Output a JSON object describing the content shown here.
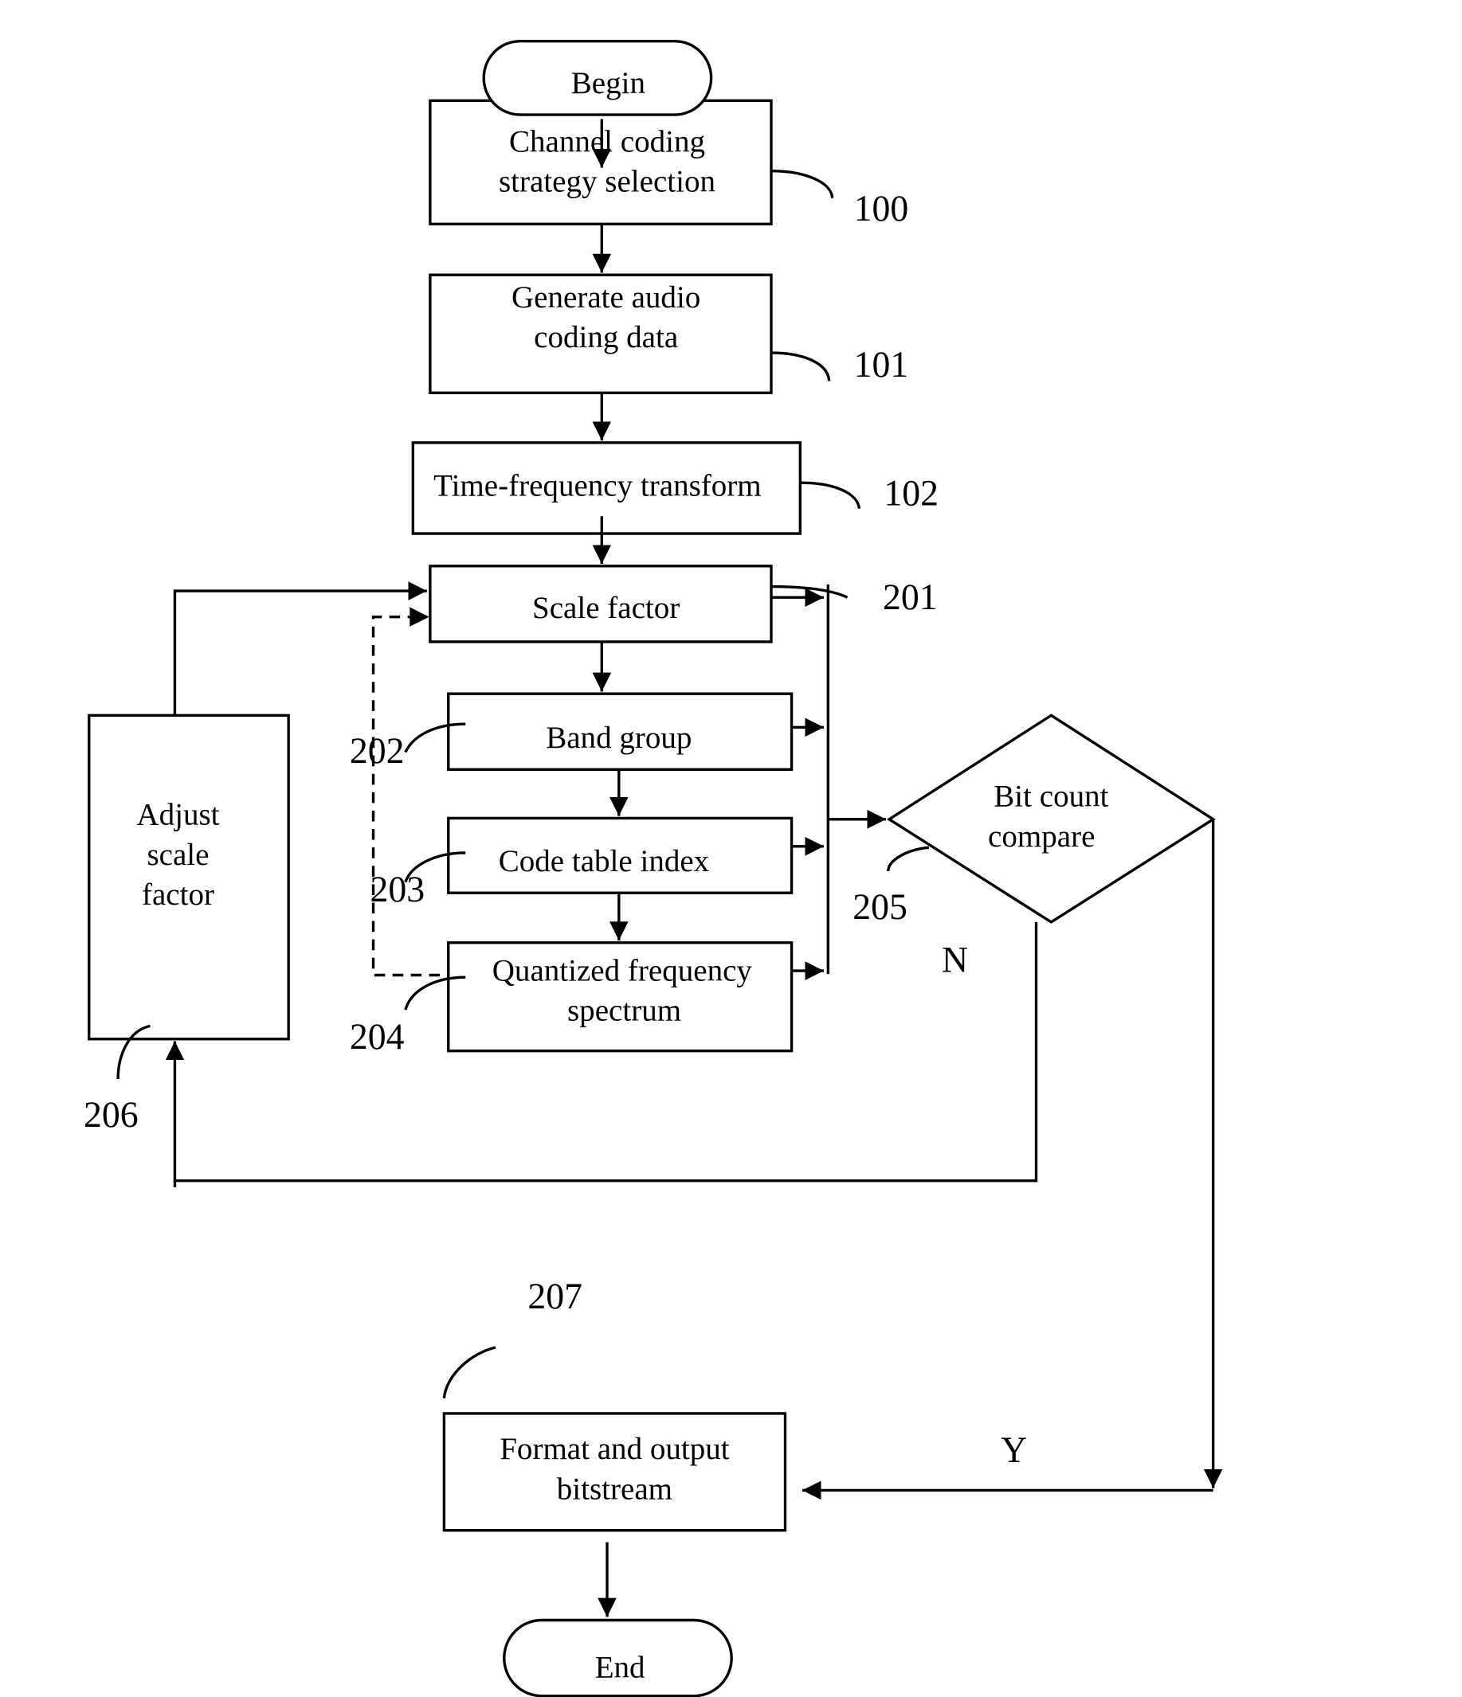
{
  "diagram": {
    "type": "flowchart",
    "nodes": {
      "begin": {
        "label": "Begin",
        "shape": "terminator"
      },
      "n100": {
        "lines": [
          "Channel coding",
          "strategy selection"
        ],
        "ref": "100"
      },
      "n101": {
        "lines": [
          "Generate audio",
          "coding data"
        ],
        "ref": "101"
      },
      "n102": {
        "lines": [
          "Time-frequency transform"
        ],
        "ref": "102"
      },
      "n201": {
        "lines": [
          "Scale factor"
        ],
        "ref": "201"
      },
      "n202": {
        "lines": [
          "Band group"
        ],
        "ref": "202"
      },
      "n203": {
        "lines": [
          "Code table index"
        ],
        "ref": "203"
      },
      "n204": {
        "lines": [
          "Quantized  frequency",
          "spectrum"
        ],
        "ref": "204"
      },
      "n205": {
        "lines": [
          "Bit  count",
          "compare"
        ],
        "ref": "205",
        "shape": "decision"
      },
      "n206": {
        "lines": [
          "Adjust",
          "scale",
          "factor"
        ],
        "ref": "206"
      },
      "n207": {
        "lines": [
          "Format and output",
          "bitstream"
        ],
        "ref": "207"
      },
      "end": {
        "label": "End",
        "shape": "terminator"
      }
    },
    "branch_labels": {
      "no": "N",
      "yes": "Y"
    }
  }
}
